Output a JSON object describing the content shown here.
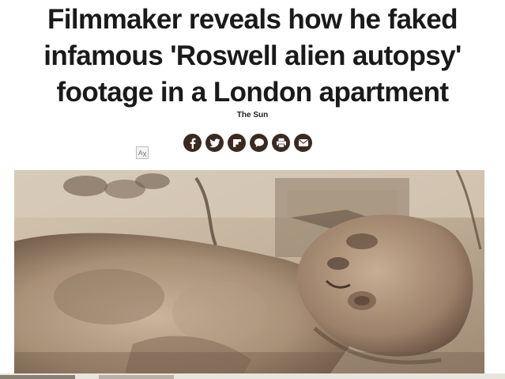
{
  "article": {
    "headline_lines": [
      "Filmmaker reveals how he faked",
      "infamous 'Roswell alien autopsy'",
      "footage in a London apartment"
    ],
    "source": "The Sun"
  },
  "share_icons": [
    "facebook-icon",
    "twitter-icon",
    "flipboard-icon",
    "comment-icon",
    "print-icon",
    "email-icon"
  ],
  "colors": {
    "share_button_bg": "#3a2b22",
    "headline_text": "#1a1a1a",
    "photo_tone": "#b7a48f"
  }
}
